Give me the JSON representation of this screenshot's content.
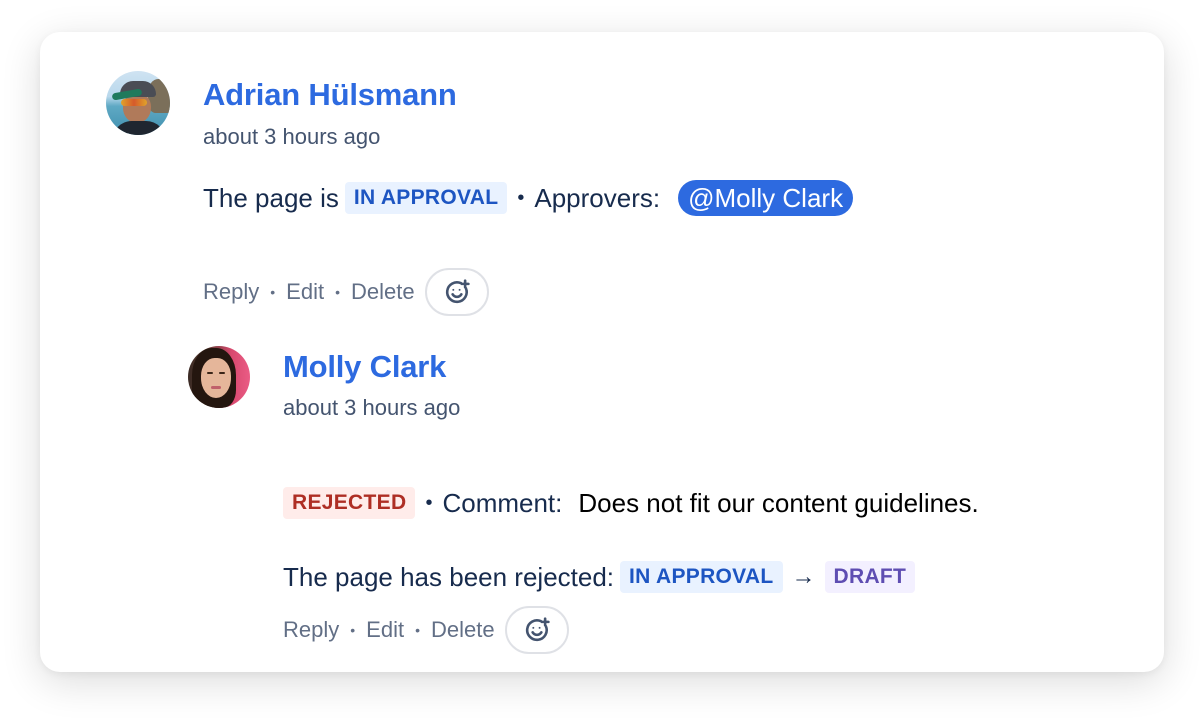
{
  "comments": [
    {
      "author": "Adrian Hülsmann",
      "time": "about 3 hours ago",
      "avatar": "avatar-adrian",
      "body": {
        "prefix": "The page is",
        "status": "IN APPROVAL",
        "separator": "•",
        "approvers_label": "Approvers:",
        "mention": "@Molly Clark"
      },
      "actions": {
        "reply": "Reply",
        "edit": "Edit",
        "delete": "Delete",
        "dot": "•",
        "emoji_icon": "add-reaction-icon"
      }
    },
    {
      "author": "Molly Clark",
      "time": "about 3 hours ago",
      "avatar": "avatar-molly",
      "body": {
        "status": "REJECTED",
        "separator": "•",
        "comment_label": "Comment:",
        "comment_text": "Does not fit our content guidelines.",
        "transition_prefix": "The page has been rejected:",
        "from_status": "IN APPROVAL",
        "arrow": "→",
        "to_status": "DRAFT"
      },
      "actions": {
        "reply": "Reply",
        "edit": "Edit",
        "delete": "Delete",
        "dot": "•",
        "emoji_icon": "add-reaction-icon"
      }
    }
  ],
  "colors": {
    "author": "#2d6ae0",
    "mention_bg": "#2d6ae0",
    "status_blue_bg": "#e9f2ff",
    "status_blue_text": "#1d55c2",
    "status_red_bg": "#ffecea",
    "status_red_text": "#ae2e24",
    "status_purple_bg": "#f3f0ff",
    "status_purple_text": "#5e4db2"
  }
}
